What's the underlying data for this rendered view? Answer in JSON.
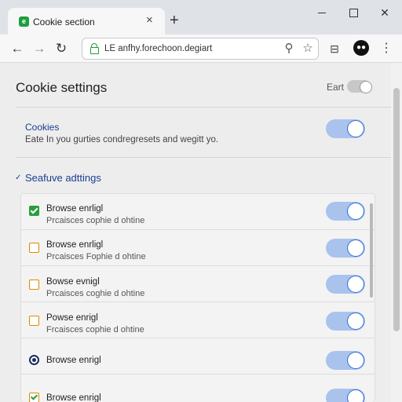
{
  "tab": {
    "title": "Cookie section",
    "close": "×",
    "new_tab": "+"
  },
  "window": {
    "minimize": "",
    "maximize": "",
    "close": "✕"
  },
  "toolbar": {
    "back": "←",
    "forward": "→",
    "reload": "↻",
    "url": "LE anfhy.forechoon.degiart",
    "extension": "⚲",
    "star": "☆",
    "side_panel": "⊟",
    "profile": "●●",
    "menu": "⋮"
  },
  "page": {
    "title": "Cookie settings",
    "top_toggle_label": "Eart",
    "top_toggle_on": false,
    "cookies": {
      "title": "Cookies",
      "description": "Eate In you gurties condregresets and wegitt yo.",
      "toggle_on": true
    },
    "section": {
      "chevron": "✓",
      "title": "Seafuve adttings"
    },
    "items": [
      {
        "icon": "checkbox-checked",
        "label": "Browse enrligl",
        "sub": "Prcaisces cophie d ohtine",
        "on": true
      },
      {
        "icon": "checkbox-empty",
        "label": "Browse enrligl",
        "sub": "Prcaisces Fophie d ohtine",
        "on": true
      },
      {
        "icon": "checkbox-empty",
        "label": "Bowse evnigl",
        "sub": "Prcaisces coghie d ohtine",
        "on": true
      },
      {
        "icon": "checkbox-empty",
        "label": "Powse enrigl",
        "sub": "Frcaisces cophie d ohtine",
        "on": true
      },
      {
        "icon": "radio-selected",
        "label": "Browse enrigl",
        "sub": "",
        "on": true
      },
      {
        "icon": "checkbox-checked-orange",
        "label": "Browse enrigl",
        "sub": "",
        "on": true
      }
    ]
  },
  "colors": {
    "accent": "#2f6fd6",
    "toggle_track": "#a9c3ec",
    "link_blue": "#1a3f8f",
    "green": "#1e9e3e",
    "orange": "#e08a00"
  }
}
